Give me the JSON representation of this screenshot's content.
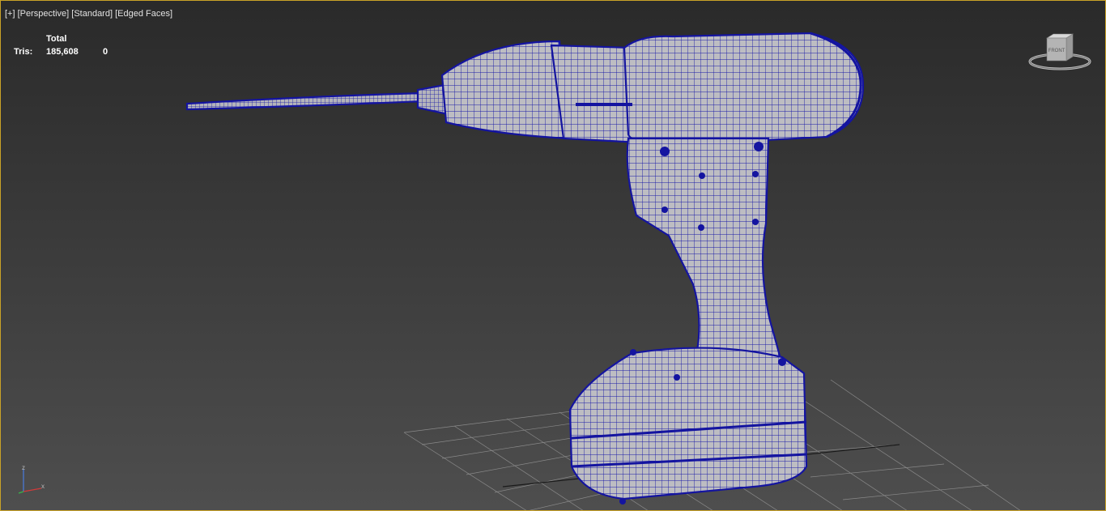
{
  "viewport": {
    "labels": [
      "[+]",
      "[Perspective]",
      "[Standard]",
      "[Edged Faces]"
    ],
    "border_color": "#c9a227"
  },
  "stats": {
    "header": "Total",
    "row_label": "Tris:",
    "total_value": "185,608",
    "selected_value": "0"
  },
  "viewcube": {
    "face_label": "FRONT"
  },
  "axis": {
    "z_label": "z",
    "x_label": "x"
  },
  "model": {
    "wire_color": "#1a1aa8",
    "surface_color": "#b9b9bd"
  },
  "icons": [
    "viewcube-icon",
    "axis-tripod-icon",
    "home-grid-icon"
  ]
}
